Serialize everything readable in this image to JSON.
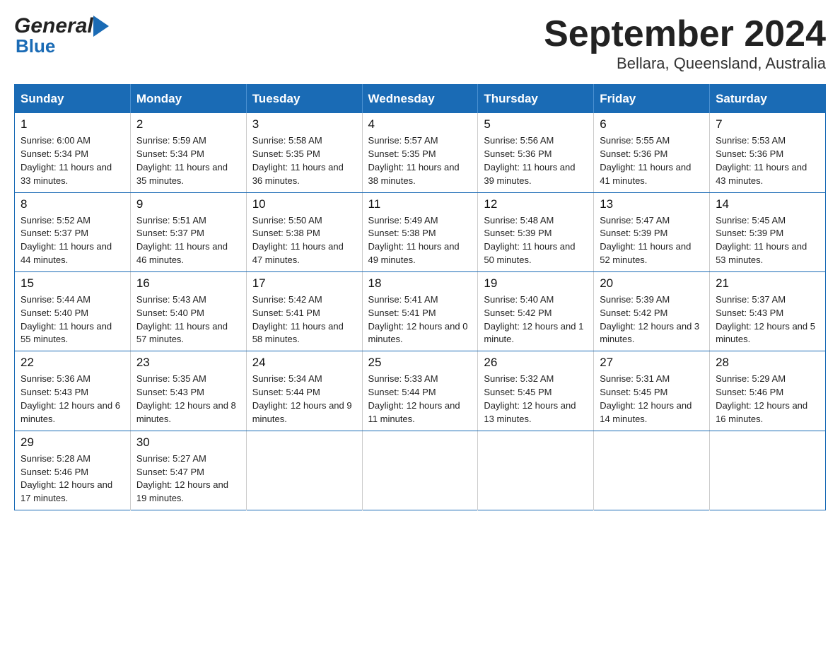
{
  "header": {
    "logo_general": "General",
    "logo_blue": "Blue",
    "title": "September 2024",
    "subtitle": "Bellara, Queensland, Australia"
  },
  "days_of_week": [
    "Sunday",
    "Monday",
    "Tuesday",
    "Wednesday",
    "Thursday",
    "Friday",
    "Saturday"
  ],
  "weeks": [
    [
      {
        "num": "1",
        "sunrise": "6:00 AM",
        "sunset": "5:34 PM",
        "daylight": "11 hours and 33 minutes."
      },
      {
        "num": "2",
        "sunrise": "5:59 AM",
        "sunset": "5:34 PM",
        "daylight": "11 hours and 35 minutes."
      },
      {
        "num": "3",
        "sunrise": "5:58 AM",
        "sunset": "5:35 PM",
        "daylight": "11 hours and 36 minutes."
      },
      {
        "num": "4",
        "sunrise": "5:57 AM",
        "sunset": "5:35 PM",
        "daylight": "11 hours and 38 minutes."
      },
      {
        "num": "5",
        "sunrise": "5:56 AM",
        "sunset": "5:36 PM",
        "daylight": "11 hours and 39 minutes."
      },
      {
        "num": "6",
        "sunrise": "5:55 AM",
        "sunset": "5:36 PM",
        "daylight": "11 hours and 41 minutes."
      },
      {
        "num": "7",
        "sunrise": "5:53 AM",
        "sunset": "5:36 PM",
        "daylight": "11 hours and 43 minutes."
      }
    ],
    [
      {
        "num": "8",
        "sunrise": "5:52 AM",
        "sunset": "5:37 PM",
        "daylight": "11 hours and 44 minutes."
      },
      {
        "num": "9",
        "sunrise": "5:51 AM",
        "sunset": "5:37 PM",
        "daylight": "11 hours and 46 minutes."
      },
      {
        "num": "10",
        "sunrise": "5:50 AM",
        "sunset": "5:38 PM",
        "daylight": "11 hours and 47 minutes."
      },
      {
        "num": "11",
        "sunrise": "5:49 AM",
        "sunset": "5:38 PM",
        "daylight": "11 hours and 49 minutes."
      },
      {
        "num": "12",
        "sunrise": "5:48 AM",
        "sunset": "5:39 PM",
        "daylight": "11 hours and 50 minutes."
      },
      {
        "num": "13",
        "sunrise": "5:47 AM",
        "sunset": "5:39 PM",
        "daylight": "11 hours and 52 minutes."
      },
      {
        "num": "14",
        "sunrise": "5:45 AM",
        "sunset": "5:39 PM",
        "daylight": "11 hours and 53 minutes."
      }
    ],
    [
      {
        "num": "15",
        "sunrise": "5:44 AM",
        "sunset": "5:40 PM",
        "daylight": "11 hours and 55 minutes."
      },
      {
        "num": "16",
        "sunrise": "5:43 AM",
        "sunset": "5:40 PM",
        "daylight": "11 hours and 57 minutes."
      },
      {
        "num": "17",
        "sunrise": "5:42 AM",
        "sunset": "5:41 PM",
        "daylight": "11 hours and 58 minutes."
      },
      {
        "num": "18",
        "sunrise": "5:41 AM",
        "sunset": "5:41 PM",
        "daylight": "12 hours and 0 minutes."
      },
      {
        "num": "19",
        "sunrise": "5:40 AM",
        "sunset": "5:42 PM",
        "daylight": "12 hours and 1 minute."
      },
      {
        "num": "20",
        "sunrise": "5:39 AM",
        "sunset": "5:42 PM",
        "daylight": "12 hours and 3 minutes."
      },
      {
        "num": "21",
        "sunrise": "5:37 AM",
        "sunset": "5:43 PM",
        "daylight": "12 hours and 5 minutes."
      }
    ],
    [
      {
        "num": "22",
        "sunrise": "5:36 AM",
        "sunset": "5:43 PM",
        "daylight": "12 hours and 6 minutes."
      },
      {
        "num": "23",
        "sunrise": "5:35 AM",
        "sunset": "5:43 PM",
        "daylight": "12 hours and 8 minutes."
      },
      {
        "num": "24",
        "sunrise": "5:34 AM",
        "sunset": "5:44 PM",
        "daylight": "12 hours and 9 minutes."
      },
      {
        "num": "25",
        "sunrise": "5:33 AM",
        "sunset": "5:44 PM",
        "daylight": "12 hours and 11 minutes."
      },
      {
        "num": "26",
        "sunrise": "5:32 AM",
        "sunset": "5:45 PM",
        "daylight": "12 hours and 13 minutes."
      },
      {
        "num": "27",
        "sunrise": "5:31 AM",
        "sunset": "5:45 PM",
        "daylight": "12 hours and 14 minutes."
      },
      {
        "num": "28",
        "sunrise": "5:29 AM",
        "sunset": "5:46 PM",
        "daylight": "12 hours and 16 minutes."
      }
    ],
    [
      {
        "num": "29",
        "sunrise": "5:28 AM",
        "sunset": "5:46 PM",
        "daylight": "12 hours and 17 minutes."
      },
      {
        "num": "30",
        "sunrise": "5:27 AM",
        "sunset": "5:47 PM",
        "daylight": "12 hours and 19 minutes."
      },
      null,
      null,
      null,
      null,
      null
    ]
  ],
  "labels": {
    "sunrise": "Sunrise:",
    "sunset": "Sunset:",
    "daylight": "Daylight:"
  }
}
